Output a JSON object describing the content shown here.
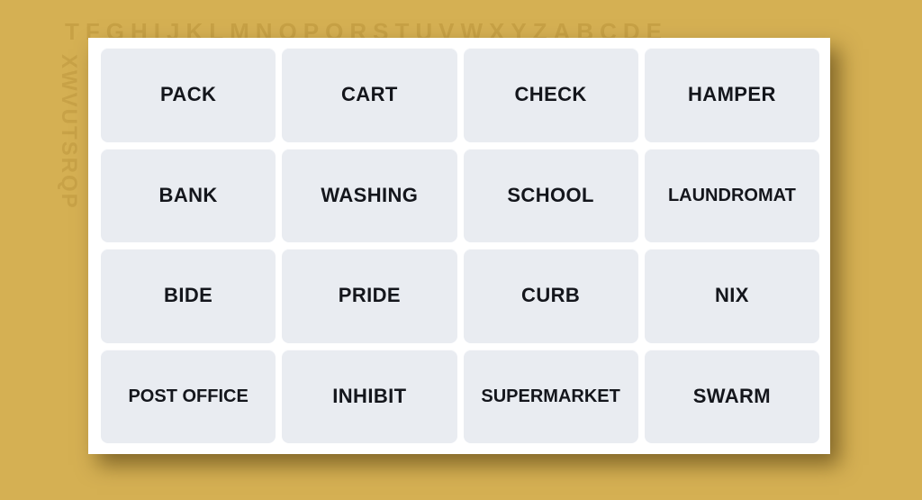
{
  "background": {
    "color": "#d5b053",
    "watermark_top": "TFGHIJKLMNOPQRSTUVWXYZABCDE",
    "watermark_left": "XWVUTSRQP"
  },
  "board": {
    "card_color": "#ffffff",
    "tile_color": "#e9ecf1",
    "text_color": "#14161c",
    "rows": 4,
    "columns": 4,
    "tiles": [
      {
        "label": "PACK"
      },
      {
        "label": "CART"
      },
      {
        "label": "CHECK"
      },
      {
        "label": "HAMPER"
      },
      {
        "label": "BANK"
      },
      {
        "label": "WASHING"
      },
      {
        "label": "SCHOOL"
      },
      {
        "label": "LAUNDROMAT"
      },
      {
        "label": "BIDE"
      },
      {
        "label": "PRIDE"
      },
      {
        "label": "CURB"
      },
      {
        "label": "NIX"
      },
      {
        "label": "POST OFFICE"
      },
      {
        "label": "INHIBIT"
      },
      {
        "label": "SUPERMARKET"
      },
      {
        "label": "SWARM"
      }
    ]
  }
}
